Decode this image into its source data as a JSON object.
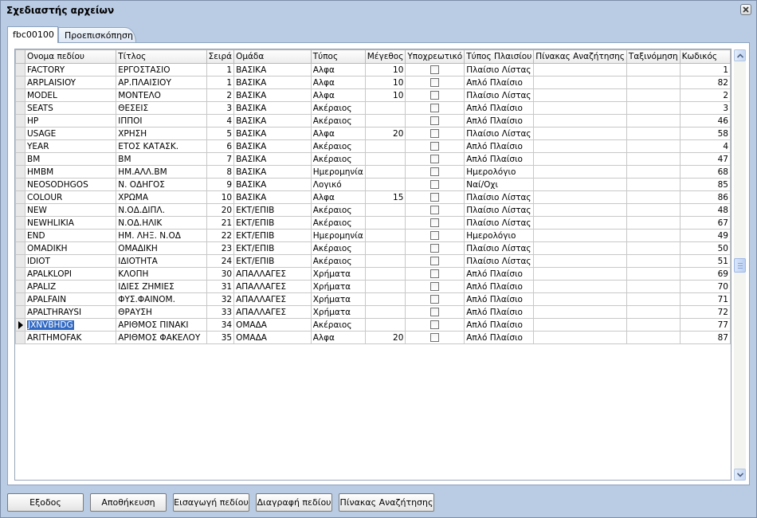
{
  "window": {
    "title": "Σχεδιαστής αρχείων"
  },
  "tabs": [
    {
      "label": "fbc00100",
      "active": true
    },
    {
      "label": "Προεπισκόπηση",
      "active": false
    }
  ],
  "grid": {
    "columns": [
      "Ονομα πεδίου",
      "Τίτλος",
      "Σειρά",
      "Ομάδα",
      "Τύπος",
      "Μέγεθος",
      "Υποχρεωτικό",
      "Τύπος Πλαισίου",
      "Πίνακας Αναζήτησης",
      "Ταξινόμηση",
      "Κωδικός"
    ],
    "selected_row": 20,
    "rows": [
      [
        "FACTORY",
        "ΕΡΓΟΣΤΑΣΙΟ",
        "1",
        "ΒΑΣΙΚΑ",
        "Αλφα",
        "10",
        false,
        "Πλαίσιο Λίστας",
        "",
        "",
        "1"
      ],
      [
        "ARPLAISIOY",
        "ΑΡ.ΠΛΑΙΣΙΟΥ",
        "1",
        "ΒΑΣΙΚΑ",
        "Αλφα",
        "10",
        false,
        "Απλό Πλαίσιο",
        "",
        "",
        "82"
      ],
      [
        "MODEL",
        "ΜΟΝΤΕΛΟ",
        "2",
        "ΒΑΣΙΚΑ",
        "Αλφα",
        "10",
        false,
        "Πλαίσιο Λίστας",
        "",
        "",
        "2"
      ],
      [
        "SEATS",
        "ΘΕΣΕΙΣ",
        "3",
        "ΒΑΣΙΚΑ",
        "Ακέραιος",
        "",
        false,
        "Απλό Πλαίσιο",
        "",
        "",
        "3"
      ],
      [
        "HP",
        "ΙΠΠΟΙ",
        "4",
        "ΒΑΣΙΚΑ",
        "Ακέραιος",
        "",
        false,
        "Απλό Πλαίσιο",
        "",
        "",
        "46"
      ],
      [
        "USAGE",
        "ΧΡΗΣΗ",
        "5",
        "ΒΑΣΙΚΑ",
        "Αλφα",
        "20",
        false,
        "Πλαίσιο Λίστας",
        "",
        "",
        "58"
      ],
      [
        "YEAR",
        "ΕΤΟΣ ΚΑΤΑΣΚ.",
        "6",
        "ΒΑΣΙΚΑ",
        "Ακέραιος",
        "",
        false,
        "Απλό Πλαίσιο",
        "",
        "",
        "4"
      ],
      [
        "BM",
        "ΒΜ",
        "7",
        "ΒΑΣΙΚΑ",
        "Ακέραιος",
        "",
        false,
        "Απλό Πλαίσιο",
        "",
        "",
        "47"
      ],
      [
        "HMBM",
        "ΗΜ.ΑΛΛ.ΒΜ",
        "8",
        "ΒΑΣΙΚΑ",
        "Ημερομηνία",
        "",
        false,
        "Ημερολόγιο",
        "",
        "",
        "68"
      ],
      [
        "NEOSODHGOS",
        "Ν. ΟΔΗΓΟΣ",
        "9",
        "ΒΑΣΙΚΑ",
        "Λογικό",
        "",
        false,
        "Ναί/Οχι",
        "",
        "",
        "85"
      ],
      [
        "COLOUR",
        "ΧΡΩΜΑ",
        "10",
        "ΒΑΣΙΚΑ",
        "Αλφα",
        "15",
        false,
        "Πλαίσιο Λίστας",
        "",
        "",
        "86"
      ],
      [
        "NEW",
        "Ν.ΟΔ.ΔΙΠΛ.",
        "20",
        "ΕΚΤ/ΕΠΙΒ",
        "Ακέραιος",
        "",
        false,
        "Πλαίσιο Λίστας",
        "",
        "",
        "48"
      ],
      [
        "NEWHLIKIA",
        "Ν.ΟΔ.ΗΛΙΚ",
        "21",
        "ΕΚΤ/ΕΠΙΒ",
        "Ακέραιος",
        "",
        false,
        "Πλαίσιο Λίστας",
        "",
        "",
        "67"
      ],
      [
        "END",
        "ΗΜ. ΛΗΞ. Ν.ΟΔ",
        "22",
        "ΕΚΤ/ΕΠΙΒ",
        "Ημερομηνία",
        "",
        false,
        "Ημερολόγιο",
        "",
        "",
        "49"
      ],
      [
        "OMADIKH",
        "ΟΜΑΔΙΚΗ",
        "23",
        "ΕΚΤ/ΕΠΙΒ",
        "Ακέραιος",
        "",
        false,
        "Πλαίσιο Λίστας",
        "",
        "",
        "50"
      ],
      [
        "IDIOT",
        "ΙΔΙΟΤΗΤΑ",
        "24",
        "ΕΚΤ/ΕΠΙΒ",
        "Ακέραιος",
        "",
        false,
        "Πλαίσιο Λίστας",
        "",
        "",
        "51"
      ],
      [
        "APALKLOPI",
        "ΚΛΟΠΗ",
        "30",
        "ΑΠΑΛΛΑΓΕΣ",
        "Χρήματα",
        "",
        false,
        "Απλό Πλαίσιο",
        "",
        "",
        "69"
      ],
      [
        "APALIZ",
        "ΙΔΙΕΣ ΖΗΜΙΕΣ",
        "31",
        "ΑΠΑΛΛΑΓΕΣ",
        "Χρήματα",
        "",
        false,
        "Απλό Πλαίσιο",
        "",
        "",
        "70"
      ],
      [
        "APALFAIN",
        "ΦΥΣ.ΦΑΙΝΟΜ.",
        "32",
        "ΑΠΑΛΛΑΓΕΣ",
        "Χρήματα",
        "",
        false,
        "Απλό Πλαίσιο",
        "",
        "",
        "71"
      ],
      [
        "APALTHRAYSI",
        "ΘΡΑΥΣΗ",
        "33",
        "ΑΠΑΛΛΑΓΕΣ",
        "Χρήματα",
        "",
        false,
        "Απλό Πλαίσιο",
        "",
        "",
        "72"
      ],
      [
        "JXNVBHDG",
        "ΑΡΙΘΜΟΣ ΠΙΝΑΚΙ",
        "34",
        "ΟΜΑΔΑ",
        "Ακέραιος",
        "",
        false,
        "Απλό Πλαίσιο",
        "",
        "",
        "77"
      ],
      [
        "ARITHMOFAK",
        "ΑΡΙΘΜΟΣ ΦΑΚΕΛΟΥ",
        "35",
        "ΟΜΑΔΑ",
        "Αλφα",
        "20",
        false,
        "Απλό Πλαίσιο",
        "",
        "",
        "87"
      ]
    ]
  },
  "buttons": {
    "exit": "Εξοδος",
    "save": "Αποθήκευση",
    "insert": "Εισαγωγή πεδίου",
    "delete": "Διαγραφή πεδίου",
    "lookup": "Πίνακας Αναζήτησης"
  },
  "icons": {
    "close": "close-icon",
    "scroll_up": "chevron-up-icon",
    "scroll_down": "chevron-down-icon",
    "row_pointer": "row-pointer-icon"
  },
  "colors": {
    "window_bg": "#b9cce4",
    "selection": "#316ac5",
    "scroll_button": "#c6d7f3"
  }
}
